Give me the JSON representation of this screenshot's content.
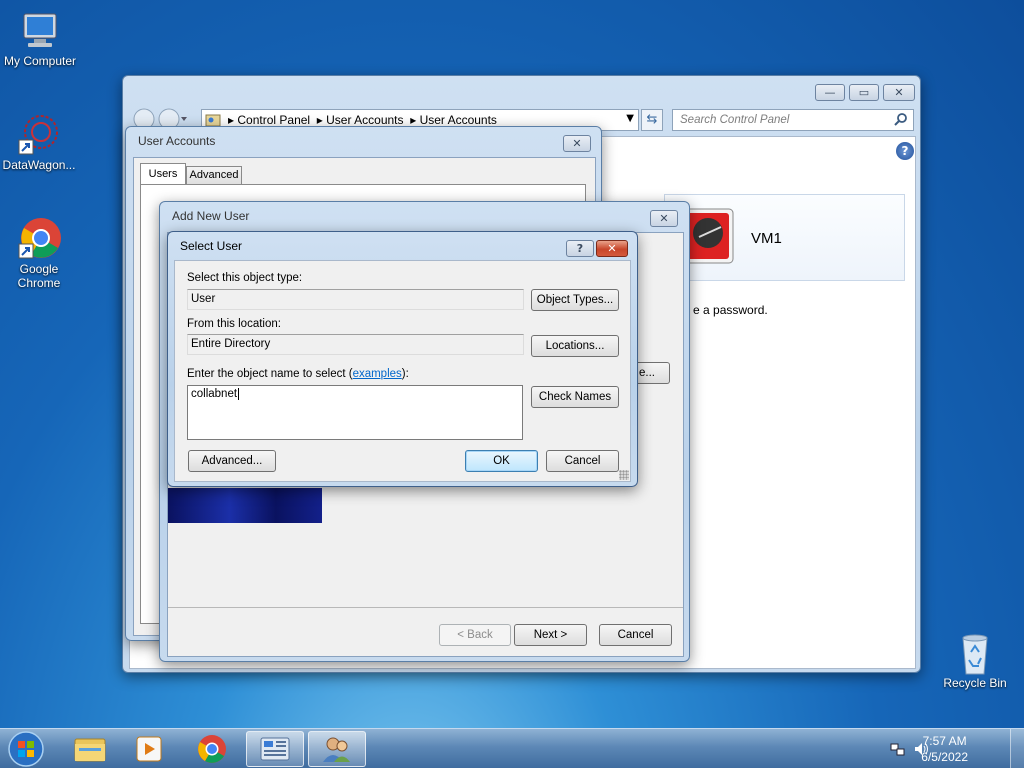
{
  "desktop": {
    "icons": [
      {
        "label": "My Computer"
      },
      {
        "label": "DataWagon..."
      },
      {
        "label": "Google Chrome"
      },
      {
        "label": "Recycle Bin"
      }
    ]
  },
  "control_panel": {
    "breadcrumb": [
      "Control Panel",
      "User Accounts",
      "User Accounts"
    ],
    "search_placeholder": "Search Control Panel",
    "vm_label": "VM1",
    "password_text": "e a password."
  },
  "user_accounts": {
    "title": "User Accounts",
    "tabs": [
      "Users",
      "Advanced"
    ]
  },
  "add_new_user": {
    "title": "Add New User",
    "back": "< Back",
    "next": "Next >",
    "cancel": "Cancel",
    "partial_button": "e..."
  },
  "select_user": {
    "title": "Select User",
    "help_icon": "?",
    "object_type_label": "Select this object type:",
    "object_type_value": "User",
    "object_types_button": "Object Types...",
    "location_label": "From this location:",
    "location_value": "Entire Directory",
    "locations_button": "Locations...",
    "enter_label": "Enter the object name to select (",
    "examples_link": "examples",
    "enter_label_end": "):",
    "object_name_value": "collabnet",
    "check_names_button": "Check Names",
    "advanced_button": "Advanced...",
    "ok_button": "OK",
    "cancel_button": "Cancel"
  },
  "taskbar": {
    "time": "7:57 AM",
    "date": "6/5/2022"
  }
}
